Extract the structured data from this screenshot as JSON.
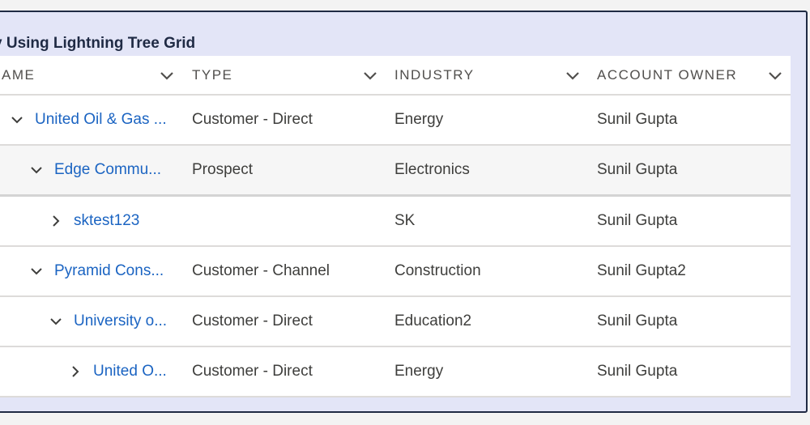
{
  "card": {
    "title": "y Using Lightning Tree Grid"
  },
  "columns": [
    {
      "label": "AME"
    },
    {
      "label": "TYPE"
    },
    {
      "label": "INDUSTRY"
    },
    {
      "label": "ACCOUNT OWNER"
    }
  ],
  "rows": [
    {
      "name": "United Oil & Gas ...",
      "type": "Customer - Direct",
      "industry": "Energy",
      "owner": "Sunil Gupta",
      "level": 1,
      "expanded": true
    },
    {
      "name": "Edge Commu...",
      "type": "Prospect",
      "industry": "Electronics",
      "owner": "Sunil Gupta",
      "level": 2,
      "expanded": true,
      "selected": true
    },
    {
      "name": "sktest123",
      "type": "",
      "industry": "SK",
      "owner": "Sunil Gupta",
      "level": 3,
      "expanded": false
    },
    {
      "name": "Pyramid Cons...",
      "type": "Customer - Channel",
      "industry": "Construction",
      "owner": "Sunil Gupta2",
      "level": 2,
      "expanded": true
    },
    {
      "name": "University o...",
      "type": "Customer - Direct",
      "industry": "Education2",
      "owner": "Sunil Gupta",
      "level": 3,
      "expanded": true
    },
    {
      "name": "United O...",
      "type": "Customer - Direct",
      "industry": "Energy",
      "owner": "Sunil Gupta",
      "level": 4,
      "expanded": false
    }
  ],
  "colors": {
    "link": "#1b64c2",
    "card_background": "#e3e5f7",
    "card_border": "#1f2a44"
  }
}
